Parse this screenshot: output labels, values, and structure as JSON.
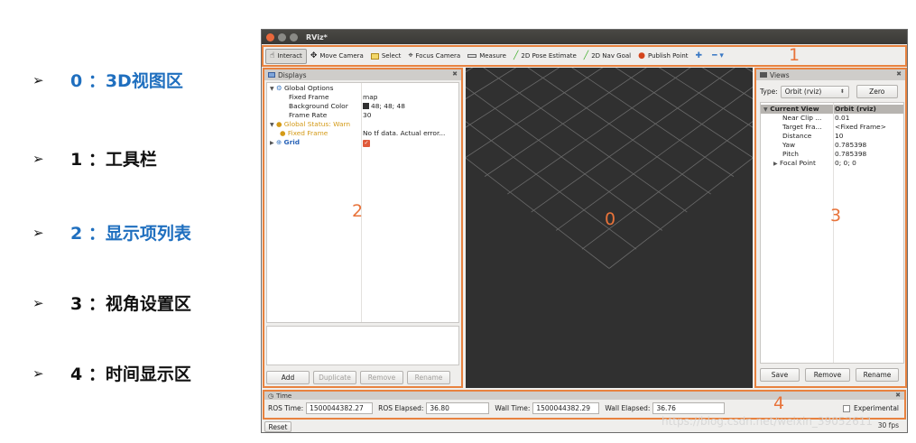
{
  "legend": [
    {
      "arrow": "➢",
      "text": "0 ：3D视图区",
      "color": "#1f6fbf"
    },
    {
      "arrow": "➢",
      "text": "1 ：工具栏",
      "color": "#111111"
    },
    {
      "arrow": "➢",
      "text": "2 ：显示项列表",
      "color": "#1f6fbf"
    },
    {
      "arrow": "➢",
      "text": "3 ：视角设置区",
      "color": "#111111"
    },
    {
      "arrow": "➢",
      "text": "4 ：时间显示区",
      "color": "#111111"
    }
  ],
  "window": {
    "title": "RViz*"
  },
  "toolbar": {
    "interact": "Interact",
    "move_camera": "Move Camera",
    "select": "Select",
    "focus_camera": "Focus Camera",
    "measure": "Measure",
    "pose_estimate": "2D Pose Estimate",
    "nav_goal": "2D Nav Goal",
    "publish_point": "Publish Point",
    "add_icon": "✚",
    "more_icon": "━ ▾"
  },
  "annotations": {
    "n0": "0",
    "n1": "1",
    "n2": "2",
    "n3": "3",
    "n4": "4"
  },
  "displays": {
    "title": "Displays",
    "close": "✖",
    "rows": [
      {
        "key": "Global Options",
        "value": ""
      },
      {
        "key": "Fixed Frame",
        "value": "map"
      },
      {
        "key": "Background Color",
        "value": "48; 48; 48"
      },
      {
        "key": "Frame Rate",
        "value": "30"
      },
      {
        "key": "Global Status: Warn",
        "value": ""
      },
      {
        "key": "Fixed Frame",
        "value": "No tf data.  Actual error..."
      },
      {
        "key": "Grid",
        "value": ""
      }
    ],
    "buttons": {
      "add": "Add",
      "duplicate": "Duplicate",
      "remove": "Remove",
      "rename": "Rename"
    }
  },
  "views": {
    "title": "Views",
    "close": "✖",
    "type_label": "Type:",
    "type_value": "Orbit (rviz)",
    "zero": "Zero",
    "rows": [
      {
        "key": "Current View",
        "value": "Orbit (rviz)"
      },
      {
        "key": "Near Clip ...",
        "value": "0.01"
      },
      {
        "key": "Target Fra...",
        "value": "<Fixed Frame>"
      },
      {
        "key": "Distance",
        "value": "10"
      },
      {
        "key": "Yaw",
        "value": "0.785398"
      },
      {
        "key": "Pitch",
        "value": "0.785398"
      },
      {
        "key": "Focal Point",
        "value": "0; 0; 0"
      }
    ],
    "buttons": {
      "save": "Save",
      "remove": "Remove",
      "rename": "Rename"
    }
  },
  "time": {
    "title": "Time",
    "close": "✖",
    "ros_time_label": "ROS Time:",
    "ros_time": "1500044382.27",
    "ros_elapsed_label": "ROS Elapsed:",
    "ros_elapsed": "36.80",
    "wall_time_label": "Wall Time:",
    "wall_time": "1500044382.29",
    "wall_elapsed_label": "Wall Elapsed:",
    "wall_elapsed": "36.76",
    "experimental": "Experimental"
  },
  "status": {
    "reset": "Reset",
    "fps": "30 fps"
  },
  "watermark": "https://blog.csdn.net/weixin_39052611",
  "colors": {
    "accent": "#e8823f",
    "view_bg": "#303030",
    "legend_blue": "#1f6fbf"
  }
}
